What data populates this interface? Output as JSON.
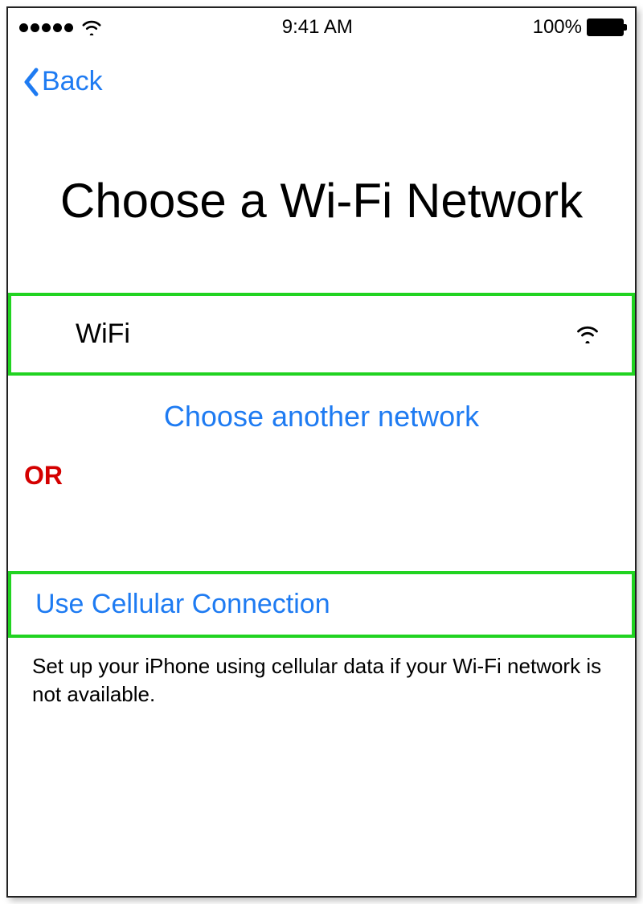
{
  "status_bar": {
    "time": "9:41 AM",
    "battery_text": "100%"
  },
  "nav": {
    "back_label": "Back"
  },
  "title": "Choose a Wi-Fi Network",
  "wifi_row": {
    "name": "WiFi"
  },
  "choose_another_label": "Choose another network",
  "or_label": "OR",
  "cellular_label": "Use Cellular Connection",
  "footnote": "Set up your iPhone using cellular data if your Wi-Fi network is not available."
}
